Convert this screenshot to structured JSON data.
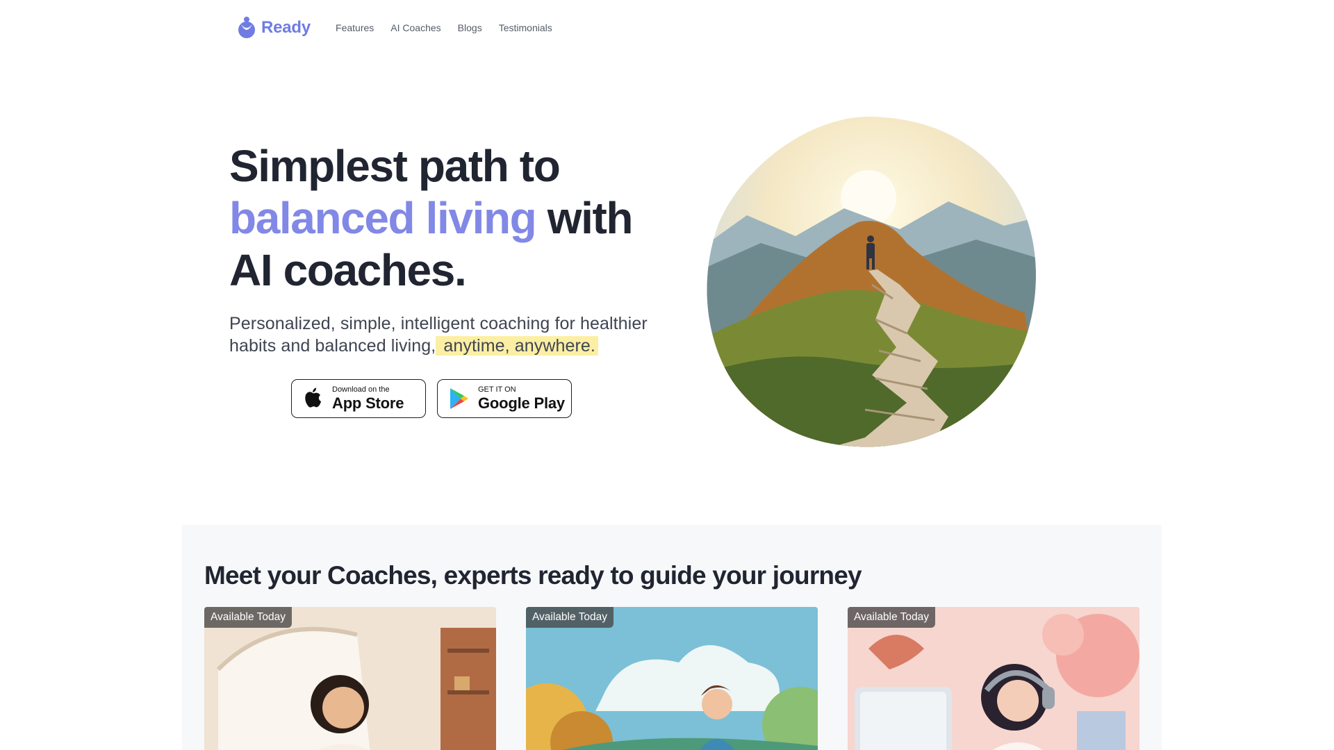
{
  "brand": {
    "name": "Ready",
    "color": "#6f7ce3"
  },
  "nav": {
    "links": [
      "Features",
      "AI Coaches",
      "Blogs",
      "Testimonials"
    ]
  },
  "hero": {
    "title_line1": "Simplest path to",
    "title_accent": "balanced living",
    "title_after_accent": " with",
    "title_line3": "AI coaches.",
    "subtitle": "Personalized, simple, intelligent coaching for healthier habits and balanced living,",
    "subtitle_highlight": " anytime, anywhere.",
    "accent_color": "#8288e6",
    "highlight_color": "#fcefa4"
  },
  "store": {
    "apple": {
      "small": "Download on the",
      "big": "App Store",
      "icon": "apple-icon"
    },
    "google": {
      "small": "GET IT ON",
      "big": "Google Play",
      "icon": "google-play-icon"
    }
  },
  "coaches": {
    "title": "Meet your Coaches, experts ready to guide your journey",
    "cards": [
      {
        "badge": "Available Today"
      },
      {
        "badge": "Available Today"
      },
      {
        "badge": "Available Today"
      }
    ]
  }
}
